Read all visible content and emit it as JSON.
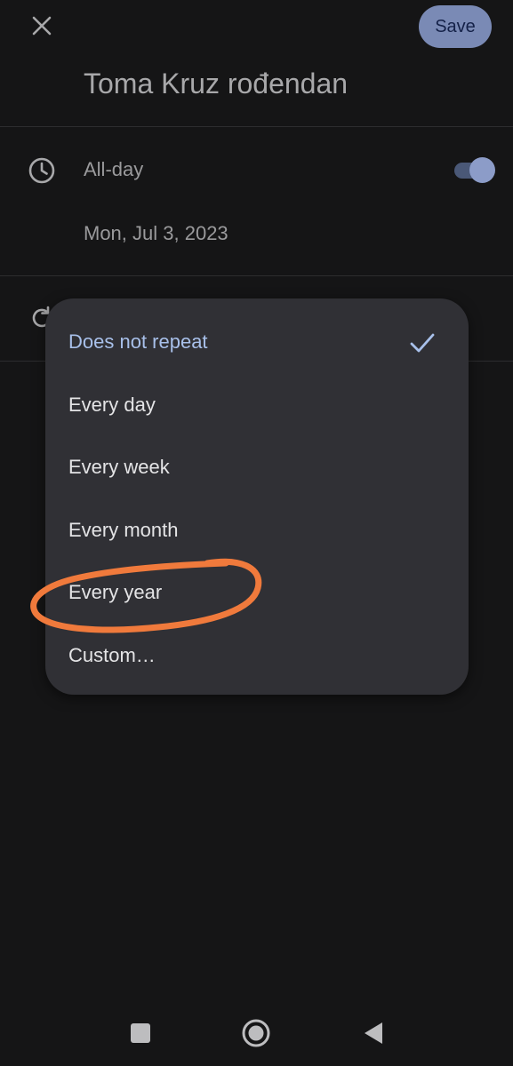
{
  "header": {
    "close_icon": "close-icon",
    "save_label": "Save",
    "event_title": "Toma Kruz rođendan"
  },
  "allday": {
    "icon": "clock-icon",
    "label": "All-day",
    "toggle_on": true
  },
  "date": {
    "label": "Mon, Jul 3, 2023"
  },
  "repeat": {
    "icon": "repeat-icon"
  },
  "repeat_menu": {
    "items": [
      {
        "label": "Does not repeat",
        "selected": true
      },
      {
        "label": "Every day",
        "selected": false
      },
      {
        "label": "Every week",
        "selected": false
      },
      {
        "label": "Every month",
        "selected": false
      },
      {
        "label": "Every year",
        "selected": false,
        "annotated": true
      },
      {
        "label": "Custom…",
        "selected": false
      }
    ]
  },
  "nav_bar": {
    "recents_icon": "square-icon",
    "home_icon": "circle-icon",
    "back_icon": "triangle-back-icon"
  },
  "colors": {
    "background": "#151516",
    "menu_bg": "#303035",
    "accent": "#a8c0ea",
    "save_bg": "#7a8ab5",
    "annotation": "#f07a3c"
  }
}
